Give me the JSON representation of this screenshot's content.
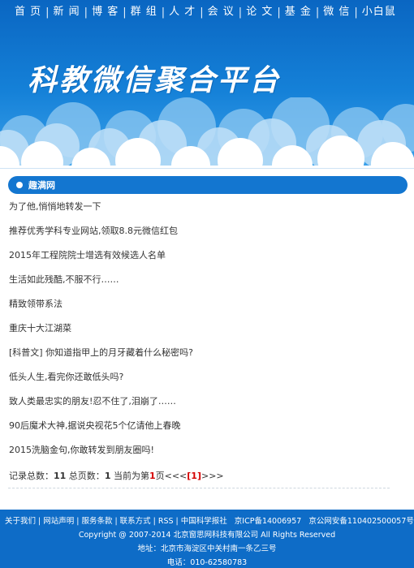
{
  "nav": {
    "items": [
      "首 页",
      "新 闻",
      "博 客",
      "群 组",
      "人 才",
      "会 议",
      "论 文",
      "基 金",
      "微 信",
      "小白鼠"
    ]
  },
  "banner": {
    "title": "科教微信聚合平台"
  },
  "section": {
    "title": "趣满网"
  },
  "articles": [
    "为了他,悄悄地转发一下",
    "推荐优秀学科专业网站,领取8.8元微信红包",
    "2015年工程院院士增选有效候选人名单",
    "生活如此残酷,不服不行……",
    "精致领带系法",
    "重庆十大江湖菜",
    "[科普文] 你知道指甲上的月牙藏着什么秘密吗?",
    "低头人生,看完你还敢低头吗?",
    "致人类最忠实的朋友!忍不住了,泪崩了……",
    "90后魔术大神,据说央视花5个亿请他上春晚",
    "2015洗脑金句,你敢转发到朋友圈吗!"
  ],
  "pager": {
    "total_label": "记录总数：",
    "total": "11",
    "pages_label": " 总页数：",
    "pages": "1",
    "current_prefix": " 当前为第",
    "current": "1",
    "current_suffix": "页",
    "prev": "<<<",
    "page_link": "[1]",
    "next": ">>>"
  },
  "footer": {
    "links": [
      "关于我们",
      "网站声明",
      "服务条款",
      "联系方式",
      "RSS",
      "中国科学报社",
      "京ICP备14006957",
      "京公网安备110402500057号"
    ],
    "copyright": "Copyright @ 2007-2014 北京窗思网科技有限公司 All Rights Reserved",
    "address": "地址：北京市海淀区中关村南一条乙三号",
    "phone": "电话：010-62580783"
  }
}
